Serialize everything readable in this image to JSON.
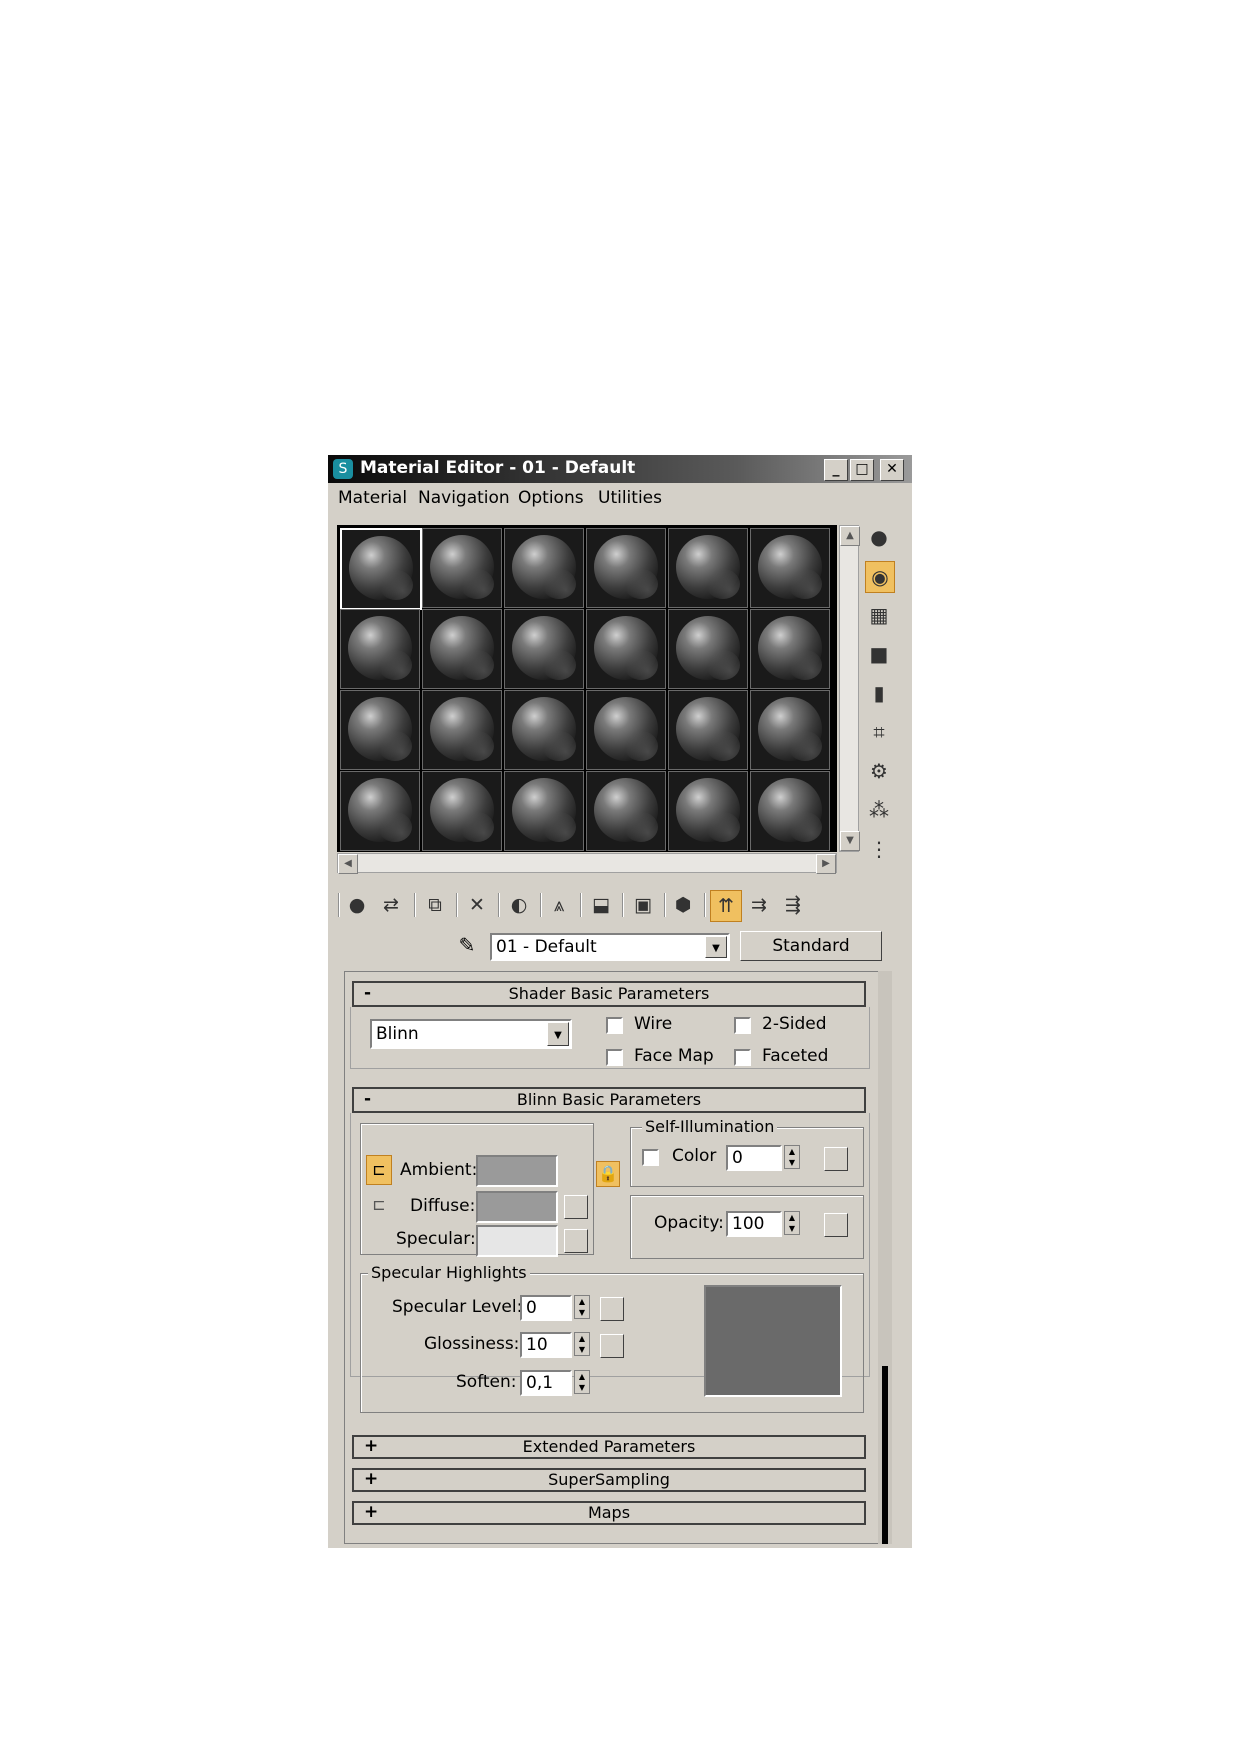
{
  "window": {
    "title": "Material Editor - 01 - Default",
    "buttons": {
      "minimize": "_",
      "maximize": "□",
      "close": "✕"
    }
  },
  "menu": [
    "Material",
    "Navigation",
    "Options",
    "Utilities"
  ],
  "sample_slots": {
    "rows": 4,
    "cols": 6,
    "active_index": 0
  },
  "right_toolbar": [
    "sample-type-icon",
    "backlight-icon",
    "background-checker-icon",
    "uv-tiling-icon",
    "video-color-check-icon",
    "make-preview-icon",
    "options-icon",
    "select-by-material-icon",
    "material-map-navigator-icon"
  ],
  "bottom_toolbar": [
    "get-material-icon",
    "put-to-scene-icon",
    "assign-to-selection-icon",
    "reset-map-icon",
    "make-unique-icon",
    "put-to-library-icon",
    "material-effects-channel-icon",
    "show-map-in-viewport-icon",
    "show-end-result-icon",
    "go-to-parent-icon",
    "go-forward-to-sibling-icon"
  ],
  "material_name": {
    "value": "01 - Default",
    "type_button": "Standard"
  },
  "rollouts": {
    "shader": {
      "sign": "-",
      "title": "Shader Basic Parameters",
      "shader_type": "Blinn",
      "wire": "Wire",
      "two_sided": "2-Sided",
      "face_map": "Face Map",
      "faceted": "Faceted"
    },
    "blinn": {
      "sign": "-",
      "title": "Blinn Basic Parameters",
      "ambient": "Ambient:",
      "diffuse": "Diffuse:",
      "specular": "Specular:",
      "colors": {
        "ambient": "#9a9a9a",
        "diffuse": "#9a9a9a",
        "specular": "#e6e6e6"
      },
      "self_illum": {
        "group": "Self-Illumination",
        "color_label": "Color",
        "value": "0"
      },
      "opacity": {
        "label": "Opacity:",
        "value": "100"
      }
    },
    "highlights": {
      "group": "Specular Highlights",
      "specular_level": {
        "label": "Specular Level:",
        "value": "0"
      },
      "glossiness": {
        "label": "Glossiness:",
        "value": "10"
      },
      "soften": {
        "label": "Soften:",
        "value": "0,1"
      },
      "curve_color": "#6a6a6a"
    },
    "collapsed": [
      {
        "sign": "+",
        "title": "Extended Parameters"
      },
      {
        "sign": "+",
        "title": "SuperSampling"
      },
      {
        "sign": "+",
        "title": "Maps"
      }
    ]
  }
}
